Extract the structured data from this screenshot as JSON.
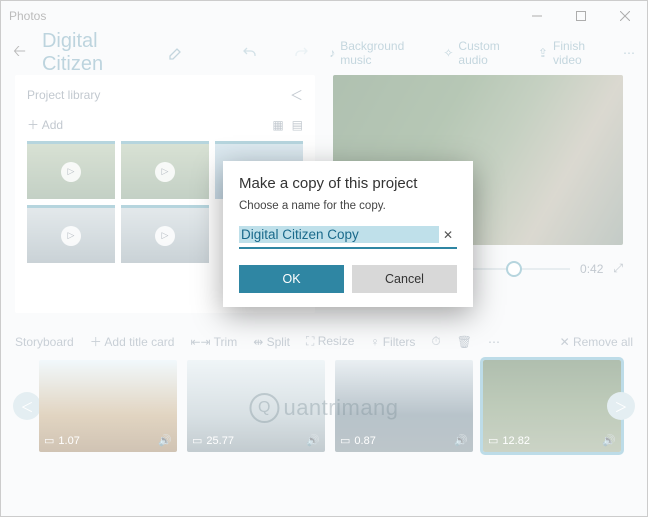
{
  "titlebar": {
    "appname": "Photos"
  },
  "header": {
    "project_title": "Digital Citizen",
    "bg_music": "Background music",
    "custom_audio": "Custom audio",
    "finish": "Finish video"
  },
  "library": {
    "title": "Project library",
    "add": "Add"
  },
  "preview": {
    "time": "0:42"
  },
  "storyboard": {
    "title": "Storyboard",
    "add_title_card": "Add title card",
    "trim": "Trim",
    "split": "Split",
    "resize": "Resize",
    "filters": "Filters",
    "remove_all": "Remove all",
    "clips": [
      {
        "dur": "1.07"
      },
      {
        "dur": "25.77"
      },
      {
        "dur": "0.87"
      },
      {
        "dur": "12.82"
      }
    ]
  },
  "dialog": {
    "title": "Make a copy of this project",
    "subtitle": "Choose a name for the copy.",
    "value": "Digital Citizen Copy",
    "ok": "OK",
    "cancel": "Cancel"
  },
  "watermark": "uantrimang"
}
